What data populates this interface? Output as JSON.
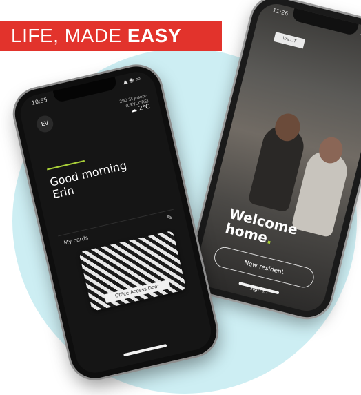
{
  "banner": {
    "prefix": "LIFE, MADE ",
    "emphasis": "EASY"
  },
  "right_phone": {
    "status_time": "11:26",
    "status_icons": "▲ ◉ ▭",
    "brand_box": "VALLIT",
    "welcome_line1": "Welcome",
    "welcome_line2": "home",
    "welcome_dot": ".",
    "primary_button": "New resident",
    "secondary_link": "Sign in"
  },
  "left_phone": {
    "status_time": "10:55",
    "status_icons": "▲ ◉ ▭",
    "avatar_initials": "EV",
    "weather_line1": "290 St Joseph",
    "weather_line2": "(DEVCORE)",
    "temperature": "2°C",
    "greeting_line1": "Good morning",
    "greeting_line2": "Erin",
    "cards_label": "My cards",
    "edit_icon": "✎",
    "card_label": "Office Access Door"
  },
  "colors": {
    "banner_red": "#e2332c",
    "accent_green": "#a9cf38",
    "circle_blue": "#cdeef3"
  }
}
